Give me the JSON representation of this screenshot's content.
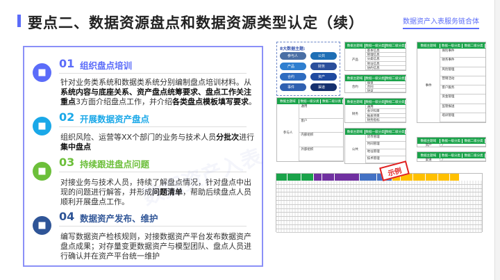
{
  "header": {
    "title": "要点二、数据资源盘点和数据资源类型认定（续）",
    "brand": "数据资产入表服务链合体"
  },
  "sections": [
    {
      "num": "01",
      "heading": "组织盘点培训",
      "color": "#5b6cf9",
      "icon": "document-person-icon",
      "parts": [
        {
          "t": "针对业务类系统和数据类系统分别编制盘点培训材料。从",
          "b": false
        },
        {
          "t": "系统内容与底座关系、资产盘点统筹要求、盘点工作关注重点",
          "b": true
        },
        {
          "t": "3方面介绍盘点工作，并介绍",
          "b": false
        },
        {
          "t": "各类盘点模板填写要求",
          "b": true
        },
        {
          "t": "。",
          "b": false
        }
      ]
    },
    {
      "num": "02",
      "heading": "开展数据资产盘点",
      "color": "#1aa8e8",
      "icon": "team-icon",
      "parts": [
        {
          "t": "组织风险、运营等XX个部门的业务与技术人员",
          "b": false
        },
        {
          "t": "分批次",
          "b": true
        },
        {
          "t": "进行",
          "b": false
        },
        {
          "t": "集中盘点",
          "b": true
        }
      ]
    },
    {
      "num": "03",
      "heading": "持续跟进盘点问题",
      "color": "#6cbf3a",
      "icon": "tools-icon",
      "parts": [
        {
          "t": "对接业务与技术人员，持续了解盘点情况，针对盘点中出现的问题进行解答，并形成",
          "b": false
        },
        {
          "t": "问题清单",
          "b": true
        },
        {
          "t": "，帮助后续盘点人员顺利开展盘点工作。",
          "b": false
        }
      ]
    },
    {
      "num": "04",
      "heading": "数据资产发布、维护",
      "color": "#2f5597",
      "icon": "crown-icon",
      "parts": [
        {
          "t": "编写数据资产检核规则，对接数据资产平台发布数据资产盘点成果；对存量变更数据资产与模型团队、盘点人员进行确认并在资产平台统一维护",
          "b": false
        }
      ]
    }
  ],
  "topics": {
    "title": "8大数据主题:",
    "items": [
      "参与人",
      "公共",
      "产品",
      "财务",
      "合约",
      "资产",
      "事件",
      "渠道"
    ]
  },
  "table_headers": [
    "数据主题域",
    "数据一级分类",
    "数据二级分类"
  ],
  "tables": [
    {
      "name": "产品",
      "rows": [
        "基本信息",
        "管理信息",
        "分类信息",
        "地址信息",
        "协约信息"
      ]
    },
    {
      "name": "合约",
      "rows": [
        "保单",
        "合同",
        "协议"
      ]
    },
    {
      "name": "财务",
      "rows": [
        "通用",
        "会计科目",
        "报表项目",
        "财务指标"
      ]
    },
    {
      "name": "公共",
      "rows": [
        "货币管理",
        "时间管理",
        "地址管理",
        "技术管理"
      ]
    },
    {
      "name": "参与人",
      "rows": [
        "通用",
        "客户",
        "内部组织",
        "外部组织"
      ]
    },
    {
      "name": "事件",
      "rows": [
        "保险事件",
        "财务事件",
        "风险管理",
        "营销活动",
        "客户服务",
        "资金管理",
        "监管报送",
        "培训管理"
      ]
    },
    {
      "name": "资产",
      "rows": [
        "/"
      ]
    },
    {
      "name": "渠道",
      "rows": [
        "/"
      ]
    }
  ],
  "stamp": "示例",
  "watermark": "数据资产入表",
  "colors": {
    "accent": "#5b6cf9",
    "green": "#1aa34a",
    "purple": "#7030a0",
    "blue": "#4472c4",
    "orange": "#ffc000",
    "stamp": "#e02020"
  }
}
